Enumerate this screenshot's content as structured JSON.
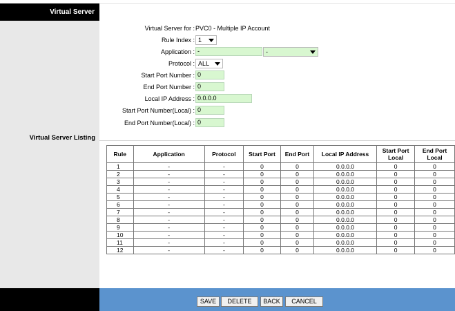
{
  "header": {
    "title": "Virtual Server"
  },
  "listing_title": "Virtual Server Listing",
  "form": {
    "virtual_server_for_label": "Virtual Server for :",
    "virtual_server_for_value": "PVC0 - Multiple IP Account",
    "rule_index_label": "Rule Index :",
    "rule_index_value": "1",
    "application_label": "Application :",
    "application_value": "-",
    "application_select_value": "-",
    "protocol_label": "Protocol :",
    "protocol_value": "ALL",
    "start_port_label": "Start Port Number :",
    "start_port_value": "0",
    "end_port_label": "End Port Number :",
    "end_port_value": "0",
    "local_ip_label": "Local IP Address :",
    "local_ip_value": "0.0.0.0",
    "start_port_local_label": "Start Port Number(Local) :",
    "start_port_local_value": "0",
    "end_port_local_label": "End Port Number(Local) :",
    "end_port_local_value": "0"
  },
  "table": {
    "headers": [
      "Rule",
      "Application",
      "Protocol",
      "Start Port",
      "End Port",
      "Local IP Address",
      "Start Port Local",
      "End Port Local"
    ],
    "rows": [
      [
        "1",
        "-",
        "-",
        "0",
        "0",
        "0.0.0.0",
        "0",
        "0"
      ],
      [
        "2",
        "-",
        "-",
        "0",
        "0",
        "0.0.0.0",
        "0",
        "0"
      ],
      [
        "3",
        "-",
        "-",
        "0",
        "0",
        "0.0.0.0",
        "0",
        "0"
      ],
      [
        "4",
        "-",
        "-",
        "0",
        "0",
        "0.0.0.0",
        "0",
        "0"
      ],
      [
        "5",
        "-",
        "-",
        "0",
        "0",
        "0.0.0.0",
        "0",
        "0"
      ],
      [
        "6",
        "-",
        "-",
        "0",
        "0",
        "0.0.0.0",
        "0",
        "0"
      ],
      [
        "7",
        "-",
        "-",
        "0",
        "0",
        "0.0.0.0",
        "0",
        "0"
      ],
      [
        "8",
        "-",
        "-",
        "0",
        "0",
        "0.0.0.0",
        "0",
        "0"
      ],
      [
        "9",
        "-",
        "-",
        "0",
        "0",
        "0.0.0.0",
        "0",
        "0"
      ],
      [
        "10",
        "-",
        "-",
        "0",
        "0",
        "0.0.0.0",
        "0",
        "0"
      ],
      [
        "11",
        "-",
        "-",
        "0",
        "0",
        "0.0.0.0",
        "0",
        "0"
      ],
      [
        "12",
        "-",
        "-",
        "0",
        "0",
        "0.0.0.0",
        "0",
        "0"
      ]
    ]
  },
  "buttons": {
    "save": "SAVE",
    "delete": "DELETE",
    "back": "BACK",
    "cancel": "CANCEL"
  },
  "colors": {
    "footer_blue": "#5b93ce",
    "input_green": "#d8f7d0",
    "left_panel": "#e8e8e8"
  },
  "icons": {
    "dropdown": "chevron-down-icon"
  }
}
